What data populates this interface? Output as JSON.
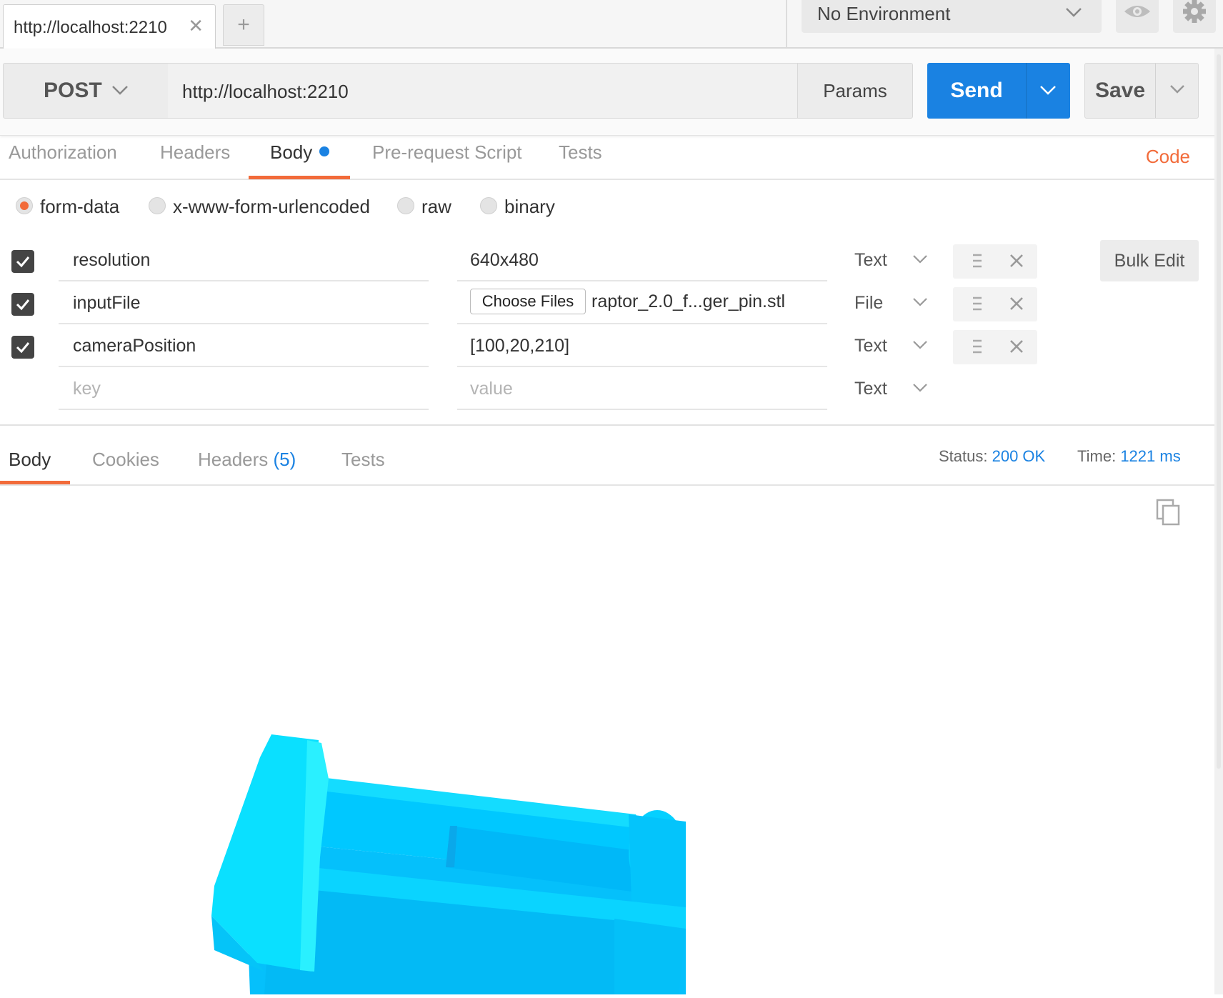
{
  "tabs": {
    "active_title": "http://localhost:2210",
    "close_glyph": "✕",
    "new_tab_glyph": "+"
  },
  "environment": {
    "selected": "No Environment",
    "icons": [
      "chevron-down-icon",
      "eye-icon",
      "gear-icon"
    ]
  },
  "request": {
    "method": "POST",
    "url": "http://localhost:2210",
    "params_label": "Params",
    "send_label": "Send",
    "save_label": "Save"
  },
  "request_tabs": {
    "items": [
      "Authorization",
      "Headers",
      "Body",
      "Pre-request Script",
      "Tests"
    ],
    "active": "Body",
    "code_label": "Code"
  },
  "body_modes": {
    "items": [
      "form-data",
      "x-www-form-urlencoded",
      "raw",
      "binary"
    ],
    "selected": "form-data"
  },
  "form_rows": [
    {
      "checked": true,
      "key": "resolution",
      "value": "640x480",
      "type": "Text"
    },
    {
      "checked": true,
      "key": "inputFile",
      "file_button": "Choose Files",
      "value": "raptor_2.0_f...ger_pin.stl",
      "type": "File"
    },
    {
      "checked": true,
      "key": "cameraPosition",
      "value": "[100,20,210]",
      "type": "Text"
    },
    {
      "checked": false,
      "key_placeholder": "key",
      "value_placeholder": "value",
      "type": "Text"
    }
  ],
  "bulk_edit_label": "Bulk Edit",
  "response": {
    "tabs": [
      "Body",
      "Cookies",
      "Headers",
      "Tests"
    ],
    "headers_count": "(5)",
    "active": "Body",
    "status_label": "Status:",
    "status_value": "200 OK",
    "time_label": "Time:",
    "time_value": "1221 ms"
  },
  "colors": {
    "accent_orange": "#f26b3a",
    "send_blue": "#1a82e2",
    "model_cyan": "#00d4ff"
  }
}
